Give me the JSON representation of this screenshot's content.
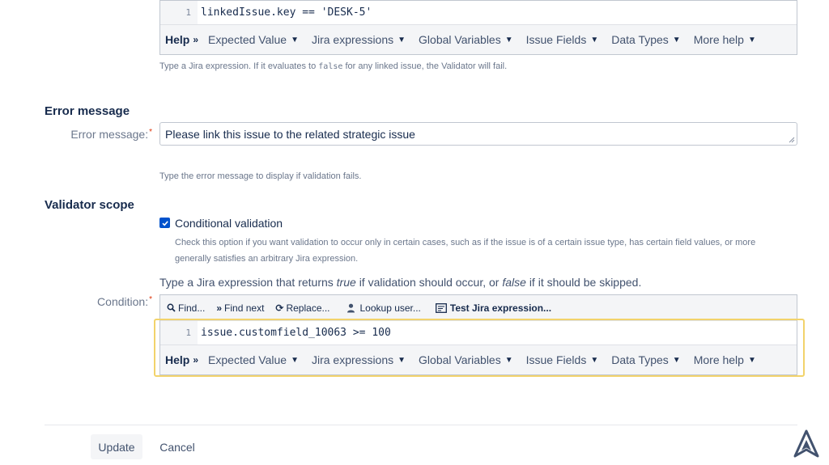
{
  "expression_editor": {
    "line_number": "1",
    "code": "linkedIssue.key == 'DESK-5'",
    "help_bar": {
      "help_label": "Help",
      "items": [
        "Expected Value",
        "Jira expressions",
        "Global Variables",
        "Issue Fields",
        "Data Types",
        "More help"
      ]
    },
    "description_before": "Type a Jira expression. If it evaluates to",
    "description_code": "false",
    "description_after": "for any linked issue, the Validator will fail."
  },
  "error_message_section": {
    "title": "Error message",
    "field_label": "Error message:",
    "value": "Please link this issue to the related strategic issue",
    "description": "Type the error message to display if validation fails."
  },
  "validator_scope": {
    "title": "Validator scope",
    "checkbox_label": "Conditional validation",
    "checkbox_checked": true,
    "checkbox_description_1": "Check this option if you want validation to occur only in certain cases, such as if the issue is of a certain issue type, has certain field values, or more",
    "checkbox_description_2": "generally satisfies an arbitrary Jira expression.",
    "condition_hint_1": "Type a Jira expression that returns",
    "condition_hint_true": "true",
    "condition_hint_2": "if validation should occur, or",
    "condition_hint_false": "false",
    "condition_hint_3": "if it should be skipped.",
    "condition_label": "Condition:",
    "toolbar": {
      "find": "Find...",
      "find_next": "Find next",
      "replace": "Replace...",
      "lookup_user": "Lookup user...",
      "test_expression": "Test Jira expression..."
    },
    "line_number": "1",
    "code": "issue.customfield_10063 >= 100",
    "help_bar": {
      "help_label": "Help",
      "items": [
        "Expected Value",
        "Jira expressions",
        "Global Variables",
        "Issue Fields",
        "Data Types",
        "More help"
      ]
    }
  },
  "actions": {
    "update_label": "Update",
    "cancel_label": "Cancel"
  },
  "icons": {
    "logo": "app-logo-icon",
    "search": "search-icon",
    "find_next": "double-chevron-right-icon",
    "replace": "replace-icon",
    "user": "user-icon",
    "test": "test-expression-icon"
  },
  "colors": {
    "highlight": "#f2d36b",
    "checkbox": "#0052cc",
    "required": "#de350b"
  }
}
